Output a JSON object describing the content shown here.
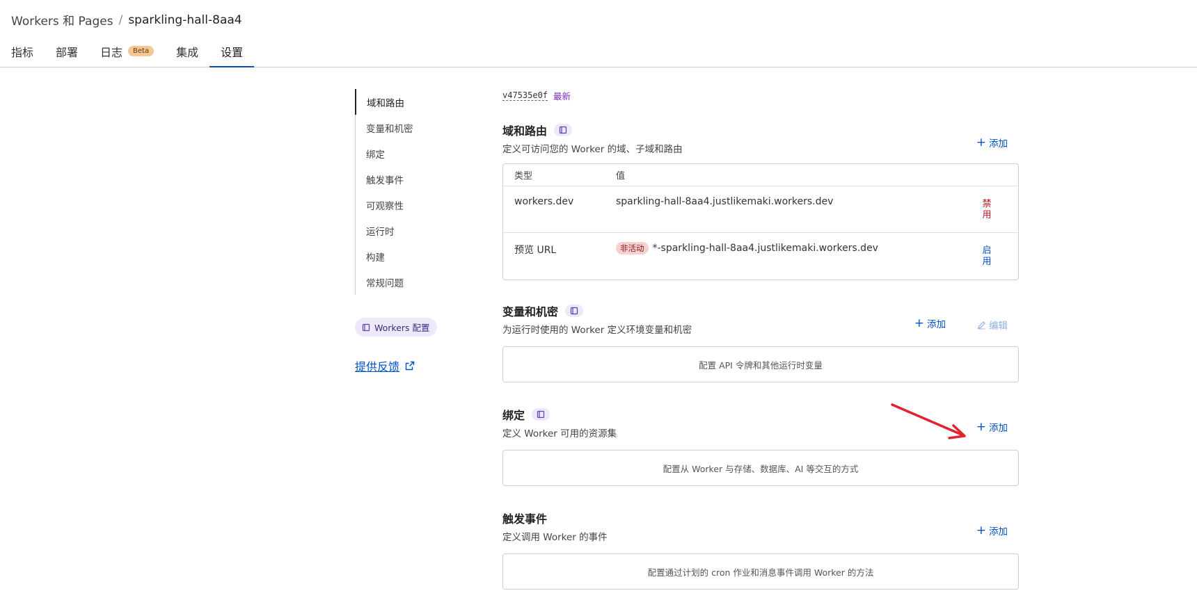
{
  "breadcrumb": {
    "root": "Workers 和 Pages",
    "separator": "/",
    "current": "sparkling-hall-8aa4"
  },
  "tabs": [
    {
      "label": "指标"
    },
    {
      "label": "部署"
    },
    {
      "label": "日志",
      "badge": "Beta"
    },
    {
      "label": "集成"
    },
    {
      "label": "设置",
      "active": true
    }
  ],
  "sidenav": {
    "items": [
      {
        "label": "域和路由",
        "active": true
      },
      {
        "label": "变量和机密"
      },
      {
        "label": "绑定"
      },
      {
        "label": "触发事件"
      },
      {
        "label": "可观察性"
      },
      {
        "label": "运行时"
      },
      {
        "label": "构建"
      },
      {
        "label": "常规问题"
      }
    ],
    "config_pill": "Workers 配置",
    "feedback": "提供反馈"
  },
  "version": {
    "id": "v47535e0f",
    "tag": "最新"
  },
  "domains": {
    "title": "域和路由",
    "desc": "定义可访问您的 Worker 的域、子域和路由",
    "add": "添加",
    "table": {
      "headers": {
        "type": "类型",
        "value": "值"
      },
      "rows": [
        {
          "type": "workers.dev",
          "value": "sparkling-hall-8aa4.justlikemaki.workers.dev",
          "action": "禁用"
        },
        {
          "type": "预览 URL",
          "badge": "非活动",
          "value": "*-sparkling-hall-8aa4.justlikemaki.workers.dev",
          "action": "启用"
        }
      ]
    }
  },
  "variables": {
    "title": "变量和机密",
    "desc": "为运行时使用的 Worker 定义环境变量和机密",
    "add": "添加",
    "edit": "编辑",
    "empty": "配置 API 令牌和其他运行时变量"
  },
  "bindings": {
    "title": "绑定",
    "desc": "定义 Worker 可用的资源集",
    "add": "添加",
    "empty": "配置从 Worker 与存储、数据库、AI 等交互的方式"
  },
  "triggers": {
    "title": "触发事件",
    "desc": "定义调用 Worker 的事件",
    "add": "添加",
    "empty": "配置通过计划的 cron 作业和消息事件调用 Worker 的方法"
  },
  "colors": {
    "accent": "#0051c3",
    "danger": "#c1121f",
    "annotation_arrow": "#e0232e",
    "doc_pill": "#ede8fa"
  }
}
